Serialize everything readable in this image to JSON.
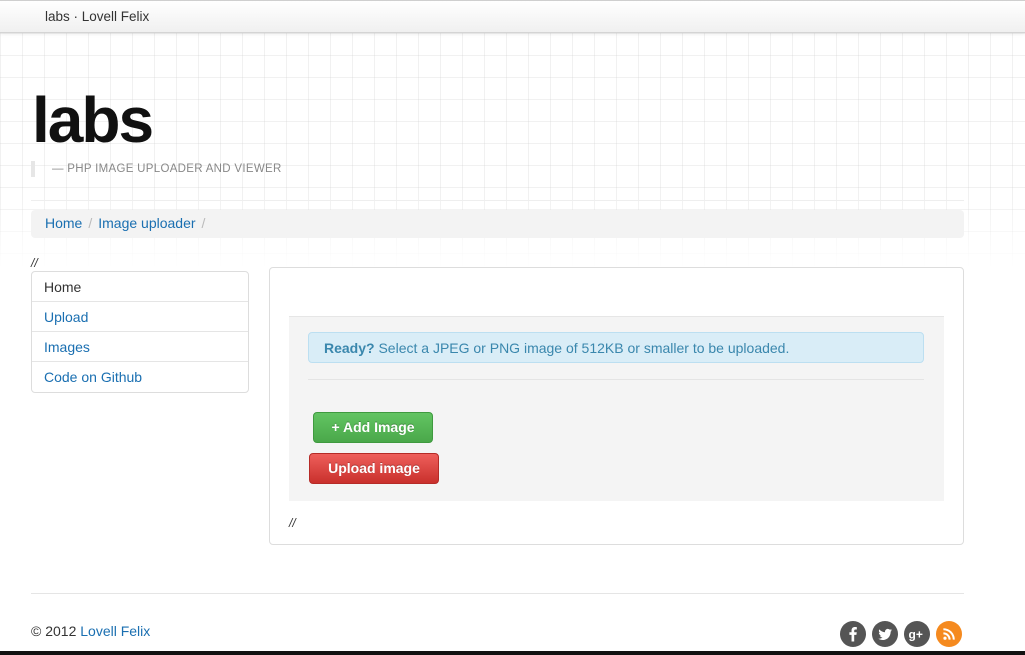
{
  "navbar": {
    "brand": "labs · Lovell Felix"
  },
  "header": {
    "title": "labs",
    "tagline": "— PHP IMAGE UPLOADER AND VIEWER"
  },
  "breadcrumb": {
    "items": [
      "Home",
      "Image uploader"
    ],
    "separator": "/"
  },
  "comment_marker": "//",
  "sidebar": {
    "items": [
      {
        "label": "Home",
        "active": true
      },
      {
        "label": "Upload"
      },
      {
        "label": "Images"
      },
      {
        "label": "Code on Github"
      }
    ]
  },
  "uploader": {
    "alert_title": "Ready?",
    "alert_text": "Select a JPEG or PNG image of 512KB or smaller to be uploaded.",
    "add_button": "+ Add Image",
    "upload_button": "Upload image"
  },
  "footer": {
    "copyright_prefix": "© 2012 ",
    "author": "Lovell Felix",
    "social_icons": [
      "facebook-icon",
      "twitter-icon",
      "google-plus-icon",
      "rss-icon"
    ]
  },
  "colors": {
    "link": "#1a6fb1",
    "success": "#5bb75b",
    "danger": "#da4f49",
    "rss": "#f58a1f"
  }
}
